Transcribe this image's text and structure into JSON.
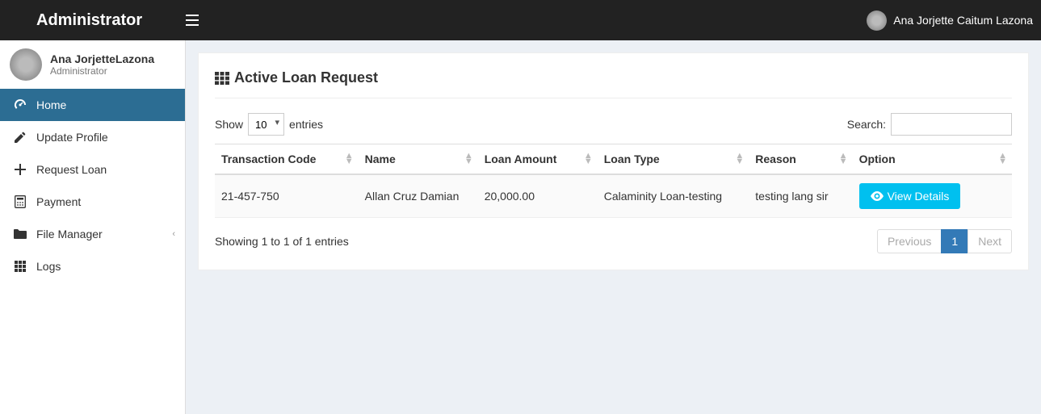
{
  "header": {
    "logo": "Administrator",
    "user_name": "Ana Jorjette Caitum Lazona"
  },
  "user_panel": {
    "name": "Ana JorjetteLazona",
    "role": "Administrator"
  },
  "sidebar": {
    "items": [
      {
        "label": "Home",
        "icon": "dashboard-icon",
        "active": true
      },
      {
        "label": "Update Profile",
        "icon": "pencil-icon"
      },
      {
        "label": "Request Loan",
        "icon": "plus-icon"
      },
      {
        "label": "Payment",
        "icon": "calculator-icon"
      },
      {
        "label": "File Manager",
        "icon": "folder-icon",
        "chevron": true
      },
      {
        "label": "Logs",
        "icon": "grid-icon"
      }
    ]
  },
  "page": {
    "title": "Active Loan Request",
    "show_label": "Show",
    "entries_label": "entries",
    "entries_value": "10",
    "search_label": "Search:",
    "columns": [
      "Transaction Code",
      "Name",
      "Loan Amount",
      "Loan Type",
      "Reason",
      "Option"
    ],
    "rows": [
      {
        "code": "21-457-750",
        "name": "Allan Cruz Damian",
        "amount": "20,000.00",
        "type": "Calaminity Loan-testing",
        "reason": "testing lang sir",
        "button": "View Details"
      }
    ],
    "info": "Showing 1 to 1 of 1 entries",
    "pager": {
      "previous": "Previous",
      "page": "1",
      "next": "Next"
    }
  }
}
